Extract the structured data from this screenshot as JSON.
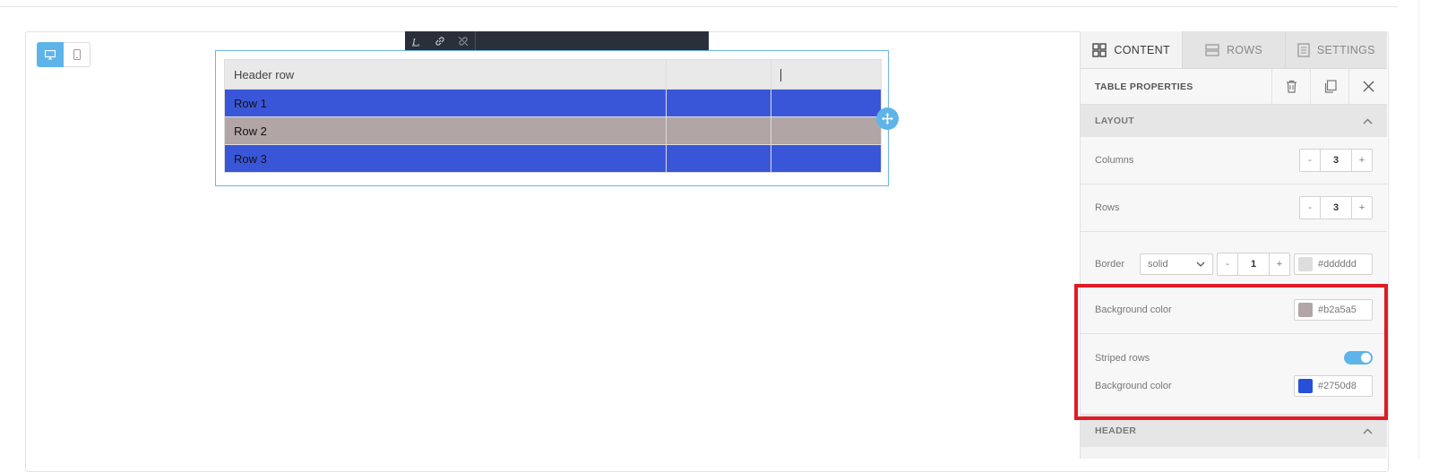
{
  "toolbar": {
    "icons": [
      "clear-format-icon",
      "link-icon",
      "unlink-icon"
    ]
  },
  "device_toggle": {
    "desktop_icon": "monitor-icon",
    "mobile_icon": "phone-icon"
  },
  "table": {
    "header": [
      "Header row",
      "",
      ""
    ],
    "rows": [
      [
        "Row 1",
        "",
        ""
      ],
      [
        "Row 2",
        "",
        ""
      ],
      [
        "Row 3",
        "",
        ""
      ]
    ]
  },
  "panel": {
    "tabs": [
      {
        "label": "CONTENT",
        "icon": "grid-icon"
      },
      {
        "label": "ROWS",
        "icon": "rows-icon"
      },
      {
        "label": "SETTINGS",
        "icon": "settings-list-icon"
      }
    ],
    "props_title": "TABLE PROPERTIES",
    "layout": {
      "title": "LAYOUT",
      "columns_label": "Columns",
      "columns_value": "3",
      "rows_label": "Rows",
      "rows_value": "3",
      "minus": "-",
      "plus": "+",
      "border_label": "Border",
      "border_style": "solid",
      "border_width": "1",
      "border_color": "#dddddd"
    },
    "background_label": "Background color",
    "background_color": "#b2a5a5",
    "striped_label": "Striped rows",
    "striped_enabled": true,
    "stripe_bg_label": "Background color",
    "stripe_color": "#2750d8",
    "header_section": "HEADER"
  },
  "colors": {
    "accent": "#5eb4e8",
    "stripe_render": "#3a56d8",
    "highlight": "#e01b24"
  }
}
